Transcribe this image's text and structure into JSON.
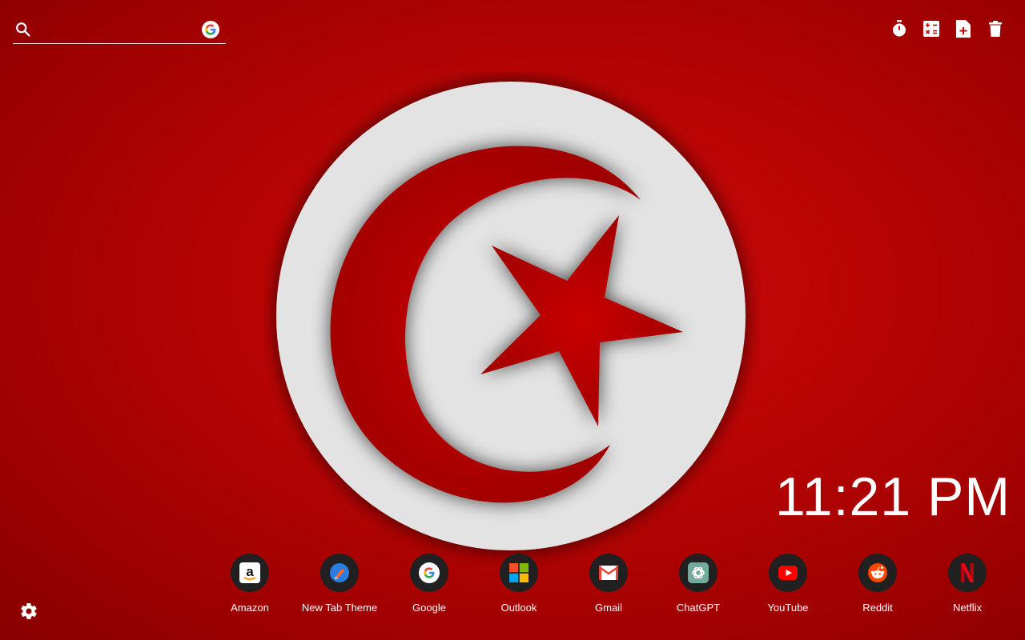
{
  "search": {
    "value": "",
    "placeholder": ""
  },
  "toolbar": {
    "icons": [
      "timer-icon",
      "calculator-icon",
      "new-note-icon",
      "trash-icon"
    ]
  },
  "clock": {
    "time": "11:21 PM"
  },
  "shortcuts": [
    {
      "label": "Amazon",
      "icon": "amazon-icon"
    },
    {
      "label": "New Tab Theme",
      "icon": "new-tab-theme-icon"
    },
    {
      "label": "Google",
      "icon": "google-icon"
    },
    {
      "label": "Outlook",
      "icon": "outlook-icon"
    },
    {
      "label": "Gmail",
      "icon": "gmail-icon"
    },
    {
      "label": "ChatGPT",
      "icon": "chatgpt-icon"
    },
    {
      "label": "YouTube",
      "icon": "youtube-icon"
    },
    {
      "label": "Reddit",
      "icon": "reddit-icon"
    },
    {
      "label": "Netflix",
      "icon": "netflix-icon"
    }
  ],
  "colors": {
    "background": "#b80404",
    "emblem_white": "#e4e4e4",
    "emblem_red": "#c00404"
  }
}
